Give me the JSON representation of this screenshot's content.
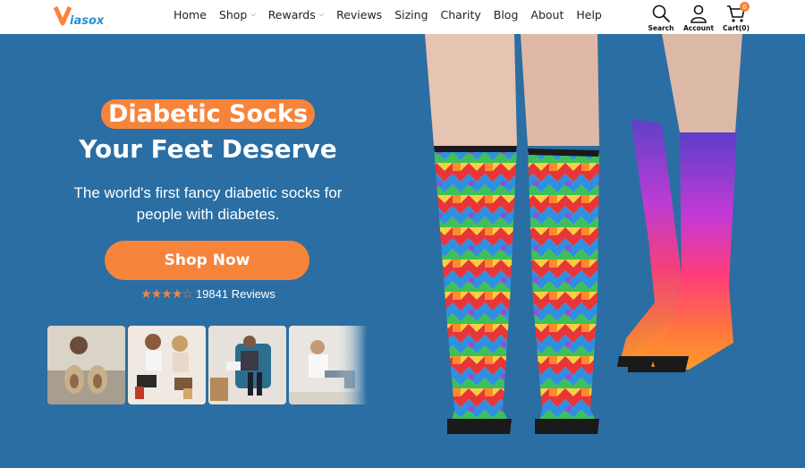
{
  "header": {
    "logo_text": "Viasox",
    "nav": [
      {
        "label": "Home",
        "has_dropdown": false
      },
      {
        "label": "Shop",
        "has_dropdown": true
      },
      {
        "label": "Rewards",
        "has_dropdown": true
      },
      {
        "label": "Reviews",
        "has_dropdown": false
      },
      {
        "label": "Sizing",
        "has_dropdown": false
      },
      {
        "label": "Charity",
        "has_dropdown": false
      },
      {
        "label": "Blog",
        "has_dropdown": false
      },
      {
        "label": "About",
        "has_dropdown": false
      },
      {
        "label": "Help",
        "has_dropdown": false
      }
    ],
    "tools": {
      "search": {
        "label": "Search",
        "icon": "search-icon"
      },
      "account": {
        "label": "Account",
        "icon": "user-icon"
      },
      "cart": {
        "label": "Cart(0)",
        "icon": "cart-icon",
        "badge": "0"
      }
    }
  },
  "hero": {
    "headline_1": "Diabetic Socks",
    "headline_2": "Your Feet Deserve",
    "subtext_1": "The world's first fancy diabetic socks for",
    "subtext_2": "people with diabetes.",
    "cta_label": "Shop Now",
    "rating_stars": "★★★★☆",
    "rating_value": 4.5,
    "reviews_label": "19841 Reviews",
    "thumbnails": [
      "thumbnail-1",
      "thumbnail-2",
      "thumbnail-3",
      "thumbnail-4"
    ]
  },
  "colors": {
    "hero_bg": "#2a6ea3",
    "accent": "#f6843b",
    "header_bg": "#ffffff"
  }
}
